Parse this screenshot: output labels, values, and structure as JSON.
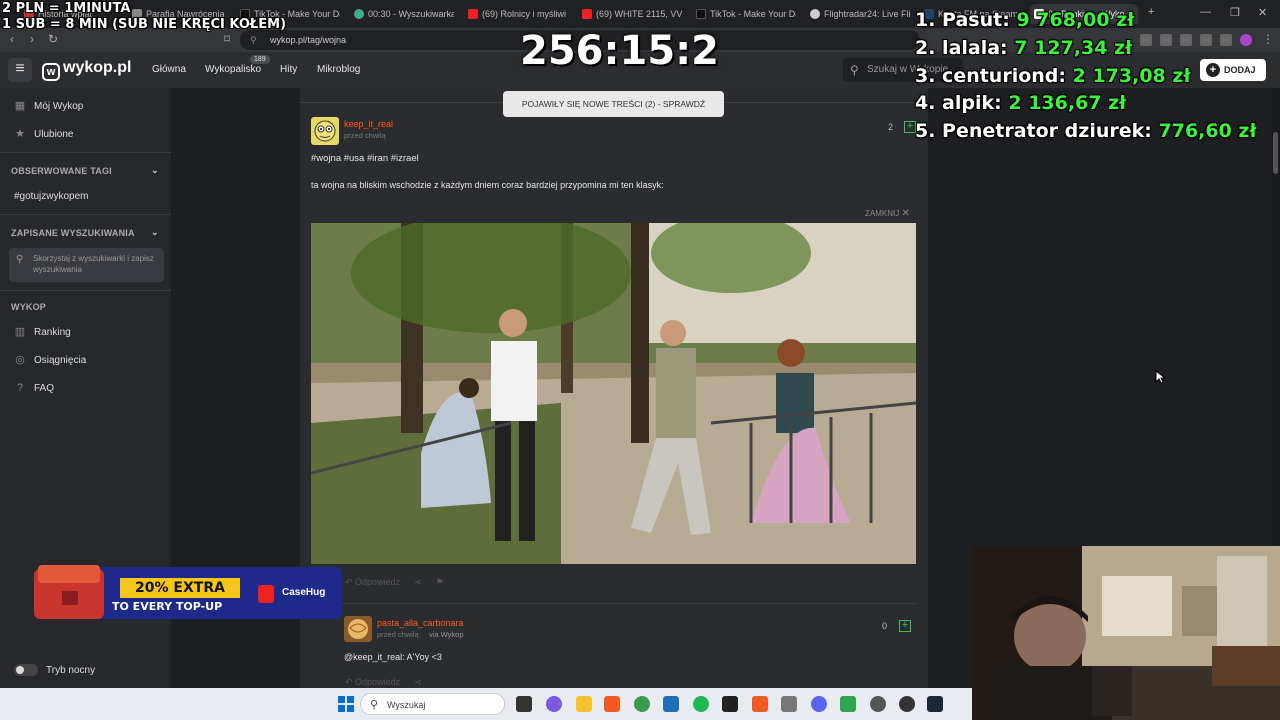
{
  "overlay": {
    "rate_line1": "2 PLN = 1MINUTA",
    "rate_line2": "1 SUB = 8 MIN (SUB NIE KRĘCI KOŁEM)",
    "timer": "256:15:2",
    "ranking": [
      {
        "label": "1. Pasut:",
        "amount": "9 768,00 zł"
      },
      {
        "label": "2. lalala:",
        "amount": "7 127,34 zł"
      },
      {
        "label": "3. centuriond:",
        "amount": "2 173,08 zł"
      },
      {
        "label": "4. alpik:",
        "amount": "2 136,67 zł"
      },
      {
        "label": "5. Penetrator dziurek:",
        "amount": "776,60 zł"
      }
    ],
    "ad": {
      "line1": "20% EXTRA",
      "line2": "TO EVERY TOP-UP",
      "brand": "CaseHug"
    }
  },
  "browser": {
    "tabs": [
      {
        "label": "Historia wpłat",
        "color": "#c33"
      },
      {
        "label": "Parafia Nawrócenia św.",
        "color": "#888"
      },
      {
        "label": "TikTok - Make Your Da",
        "color": "#111"
      },
      {
        "label": "00:30 - Wyszukiwarka",
        "color": "#4a8"
      },
      {
        "label": "(69) Rolnicy i myśliwi p",
        "color": "#e22"
      },
      {
        "label": "(69) WHITE 2115, VVS",
        "color": "#e22"
      },
      {
        "label": "TikTok - Make Your Da",
        "color": "#111"
      },
      {
        "label": "Flightradar24: Live Flig",
        "color": "#ccc"
      },
      {
        "label": "Konta FM na Steam",
        "color": "#246"
      },
      {
        "label": "0 - Ranking - Wyko",
        "color": "#fff"
      }
    ],
    "url": "wykop.pl/tag/wojna",
    "new_tab": "+",
    "minimize": "—",
    "maximize": "❐",
    "close": "✕"
  },
  "header": {
    "logo": "wykop.pl",
    "nav": [
      {
        "label": "Główna"
      },
      {
        "label": "Wykopalisko",
        "badge": "189"
      },
      {
        "label": "Hity"
      },
      {
        "label": "Mikroblog"
      }
    ],
    "search_placeholder": "Szukaj w Wykopie",
    "add_label": "DODAJ"
  },
  "sidebar": {
    "my_wykop": "Mój Wykop",
    "favorites": "Ulubione",
    "observed_tags_heading": "OBSERWOWANE TAGI",
    "observed_tag": "#gotujzwykopem",
    "saved_searches_heading": "ZAPISANE WYSZUKIWANIA",
    "saved_searches_hint": "Skorzystaj z wyszukiwarki i zapisz wyszukiwania",
    "wykop_heading": "WYKOP",
    "ranking": "Ranking",
    "achievements": "Osiągnięcia",
    "faq": "FAQ",
    "night_mode": "Tryb nocny"
  },
  "feed": {
    "new_content_banner": "POJAWIŁY SIĘ NOWE TREŚCI (2) - SPRAWDŹ",
    "post": {
      "author": "keep_it_real",
      "time": "przed chwilą",
      "votes": "2",
      "tags": "#wojna #usa #iran #izrael",
      "text": "ta wojna na bliskim wschodzie z każdym dniem coraz bardziej przypomina mi ten klasyk:",
      "collapse": "ZAMKNIJ",
      "reply": "Odpowiedz"
    },
    "comment": {
      "author": "pasta_alla_carbonara",
      "time": "przed chwilą",
      "via": "via Wykop",
      "votes": "0",
      "text": "@keep_it_real: A'Yoy <3",
      "reply": "Odpowiedz"
    }
  },
  "taskbar": {
    "search_placeholder": "Wyszukaj"
  },
  "colors": {
    "accent_orange": "#ff5917",
    "vote_green": "#3bbb5b",
    "ranking_amount": "#3cf23c"
  }
}
